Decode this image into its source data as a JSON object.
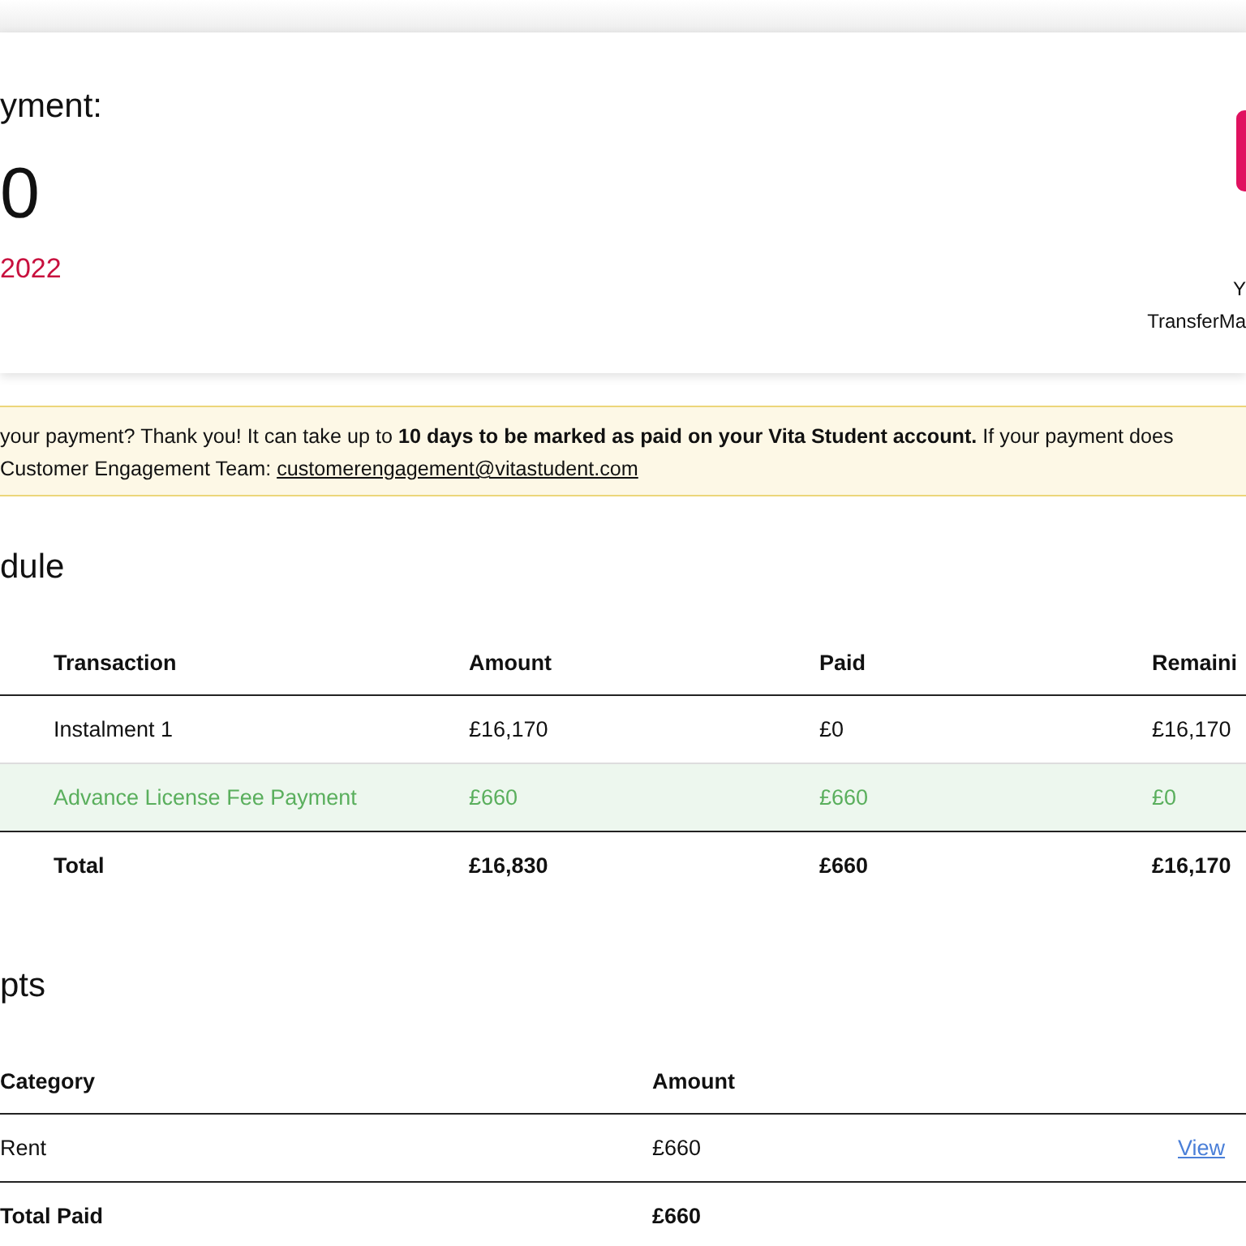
{
  "summary": {
    "title": "yment:",
    "amount": "0",
    "due_date": "2022",
    "side_line_1": "Y",
    "side_line_2": "TransferMa"
  },
  "notice": {
    "text": "your payment? Thank you! It can take up to **10 days to be marked as paid on your Vita Student account.** If your payment does",
    "team_label": "Customer Engagement Team:",
    "email": "customerengagement@vitastudent.com"
  },
  "schedule": {
    "heading": "dule",
    "columns": [
      "Transaction",
      "Amount",
      "Paid",
      "Remaini"
    ],
    "rows": [
      {
        "kind": "normal",
        "cells": [
          "Instalment 1",
          "£16,170",
          "£0",
          "£16,170"
        ]
      },
      {
        "kind": "paid",
        "cells": [
          "Advance License Fee Payment",
          "£660",
          "£660",
          "£0"
        ]
      },
      {
        "kind": "total",
        "cells": [
          "Total",
          "£16,830",
          "£660",
          "£16,170"
        ]
      }
    ]
  },
  "receipts": {
    "heading": "pts",
    "columns": [
      "Category",
      "Amount"
    ],
    "rows": [
      {
        "kind": "normal",
        "cells": [
          "Rent",
          "£660"
        ],
        "link": "View"
      },
      {
        "kind": "total",
        "cells": [
          "Total Paid",
          "£660"
        ]
      }
    ]
  }
}
